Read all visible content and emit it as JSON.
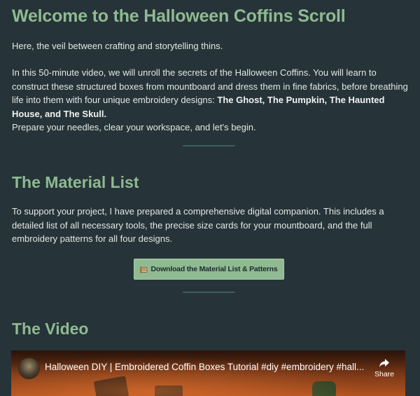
{
  "intro": {
    "title": "Welcome to the Halloween Coffins Scroll",
    "lead": "Here, the veil between crafting and storytelling thins.",
    "body_before_bold": "In this 50-minute video, we will unroll the secrets of the Halloween Coffins. You will learn to construct these structured boxes from mountboard and dress them in fine fabrics, before breathing life into them with four unique embroidery designs: ",
    "body_bold": "The Ghost, The Pumpkin, The Haunted House, and The Skull.",
    "closing": "Prepare your needles, clear your workspace, and let's begin."
  },
  "materials": {
    "title": "The Material List",
    "body": "To support your project, I have prepared a comprehensive digital companion. This includes a detailed list of all necessary tools, the precise size cards for your mountboard, and the full embroidery patterns for all four designs.",
    "download_label": "Download the Material List & Patterns",
    "download_icon": "scroll-icon"
  },
  "video_section": {
    "title": "The Video",
    "player": {
      "title": "Halloween DIY | Embroidered Coffin Boxes Tutorial #diy #embroidery #hall...",
      "share_label": "Share"
    }
  },
  "colors": {
    "background": "#263338",
    "heading": "#8fba92",
    "text": "#e3e7e6",
    "button_bg": "#8fba92"
  }
}
